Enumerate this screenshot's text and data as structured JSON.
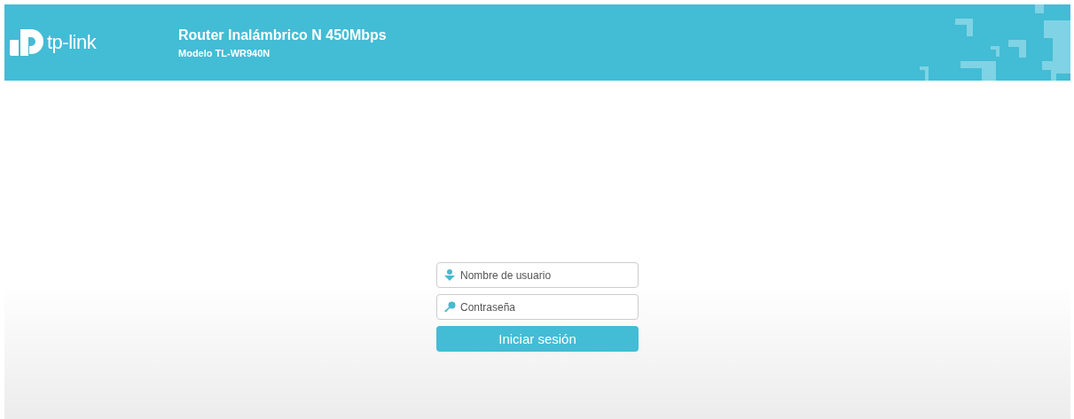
{
  "header": {
    "brand": "tp-link",
    "title": "Router Inalámbrico N 450Mbps",
    "model": "Modelo TL-WR940N"
  },
  "login": {
    "username": {
      "placeholder": "Nombre de usuario"
    },
    "password": {
      "placeholder": "Contraseña"
    },
    "button": "Iniciar sesión"
  }
}
